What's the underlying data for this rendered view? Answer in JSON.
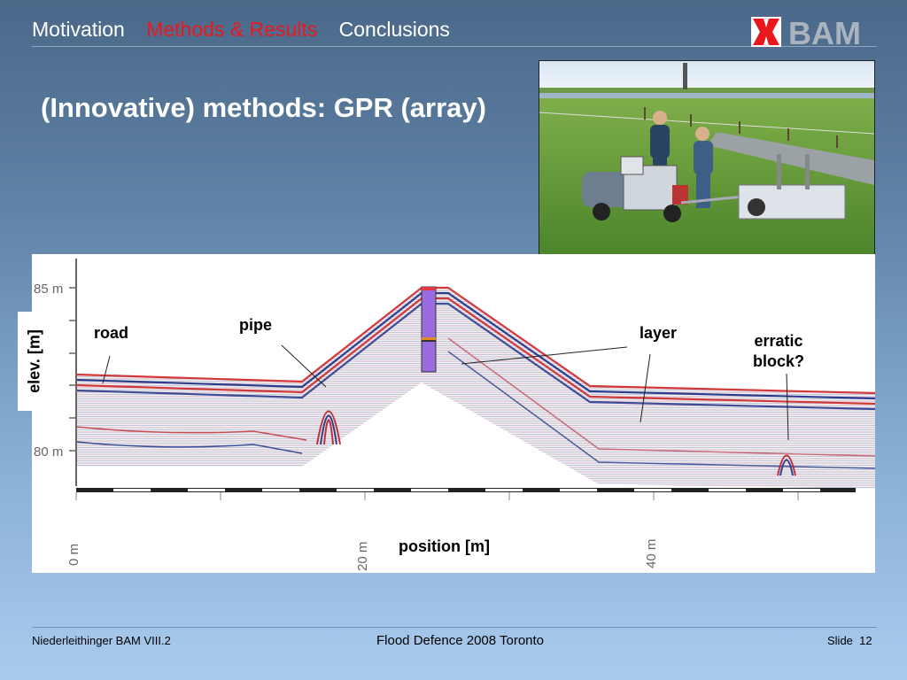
{
  "nav": {
    "items": [
      {
        "label": "Motivation"
      },
      {
        "label": "Methods & Results"
      },
      {
        "label": "Conclusions"
      }
    ],
    "active_color": "#e8191e"
  },
  "logo": {
    "text": "BAM",
    "brand_color": "#e8191e"
  },
  "title": "(Innovative) methods: GPR (array)",
  "photo": {
    "icon": "gpr-field-survey-photo"
  },
  "radargram": {
    "y_ticks": [
      "85 m",
      "80 m"
    ],
    "x_ticks": [
      "0 m",
      "20 m",
      "40 m"
    ],
    "annotations": {
      "road": "road",
      "pipe": "pipe",
      "layer": "layer",
      "erratic_line1": "erratic",
      "erratic_line2": "block?"
    },
    "y_axis_label": "elev. [m]",
    "x_axis_label": "position [m]"
  },
  "footer": {
    "left": "Niederleithinger BAM VIII.2",
    "center": "Flood Defence 2008 Toronto",
    "slide_label": "Slide",
    "slide_number": "12"
  }
}
